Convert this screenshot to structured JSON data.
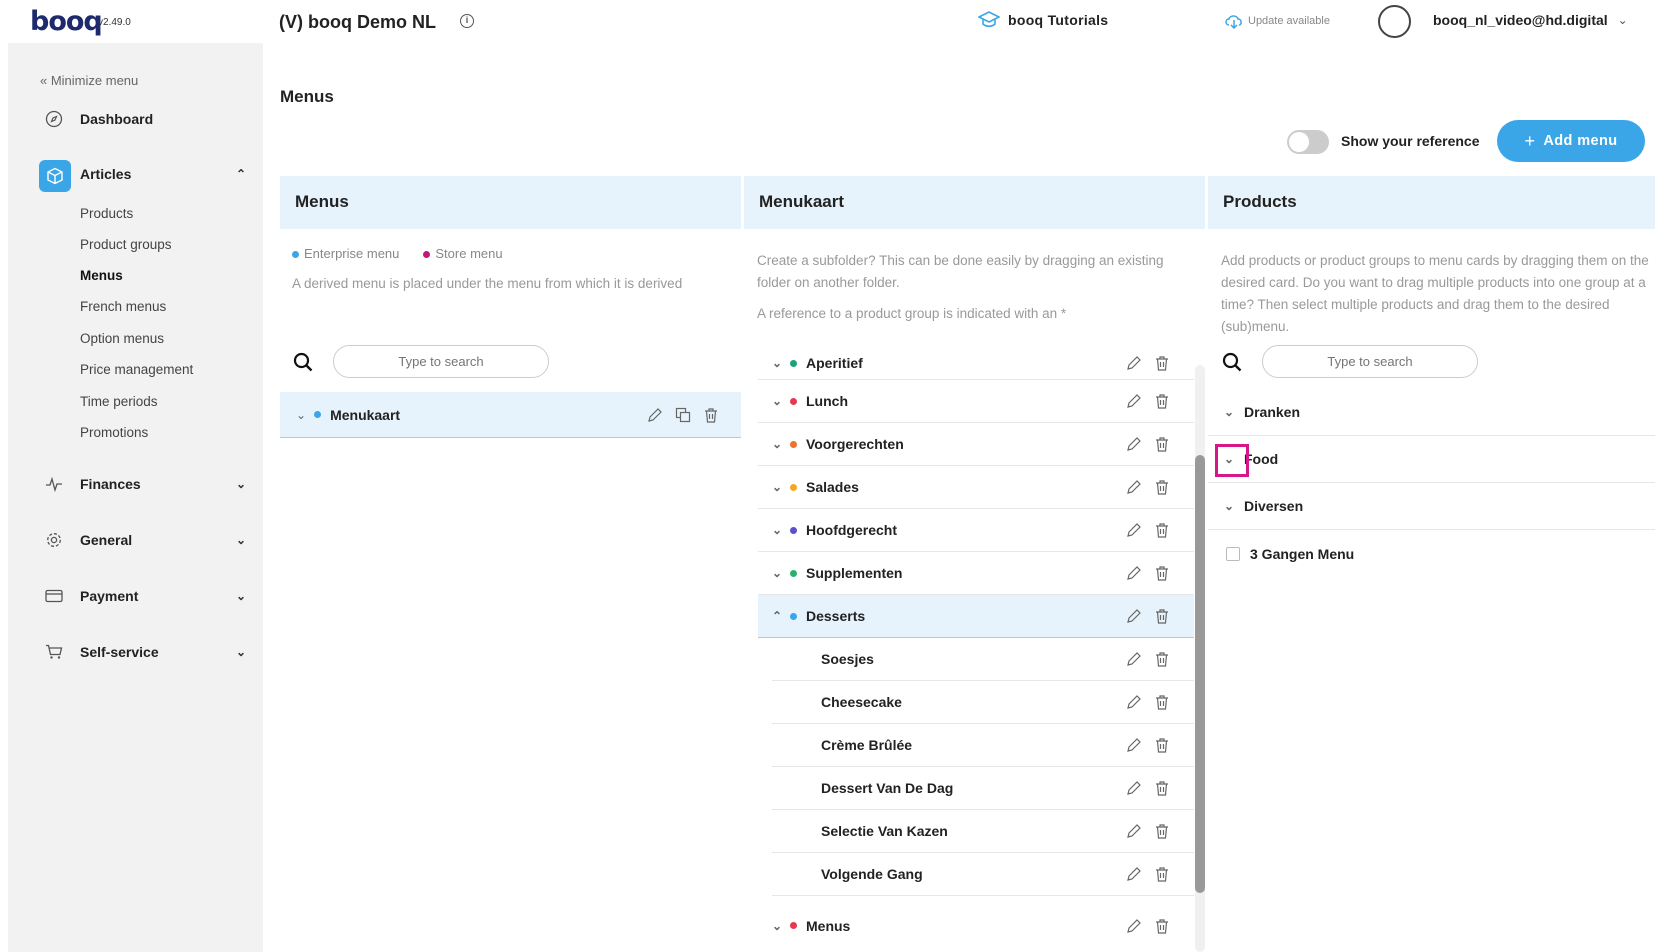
{
  "topbar": {
    "logo": "booq",
    "version": "v2.49.0",
    "venue": "(V) booq Demo NL",
    "tutorials": "booq Tutorials",
    "update": "Update available",
    "account": "booq_nl_video@hd.digital"
  },
  "sidebar": {
    "minimize": "« Minimize menu",
    "dashboard": "Dashboard",
    "articles": "Articles",
    "articles_sub": [
      "Products",
      "Product groups",
      "Menus",
      "French menus",
      "Option menus",
      "Price management",
      "Time periods",
      "Promotions"
    ],
    "finances": "Finances",
    "general": "General",
    "payment": "Payment",
    "self_service": "Self-service"
  },
  "page": {
    "title": "Menus",
    "toggle_label": "Show your reference",
    "add_button": "Add menu"
  },
  "menus_col": {
    "header": "Menus",
    "legend_enterprise": "Enterprise menu",
    "legend_store": "Store menu",
    "note": "A derived menu is placed under the menu from which it is derived",
    "search_placeholder": "Type to search",
    "item": "Menukaart"
  },
  "menukaart_col": {
    "header": "Menukaart",
    "note1": "Create a subfolder? This can be done easily by dragging an existing folder on another folder.",
    "note2": "A reference to a product group is indicated with an *",
    "rows": [
      {
        "label": "Aperitief",
        "color": "#1aa37a"
      },
      {
        "label": "Lunch",
        "color": "#e8384f"
      },
      {
        "label": "Voorgerechten",
        "color": "#f07030"
      },
      {
        "label": "Salades",
        "color": "#f5a623"
      },
      {
        "label": "Hoofdgerecht",
        "color": "#5a4fcf"
      },
      {
        "label": "Supplementen",
        "color": "#2bb06b"
      },
      {
        "label": "Desserts",
        "color": "#3aa6e8"
      }
    ],
    "children": [
      "Soesjes",
      "Cheesecake",
      "Crème Brûlée",
      "Dessert Van De Dag",
      "Selectie Van Kazen",
      "Volgende Gang"
    ],
    "last_row": {
      "label": "Menus",
      "color": "#e8384f"
    }
  },
  "products_col": {
    "header": "Products",
    "note": "Add products or product groups to menu cards by dragging them on the desired card. Do you want to drag multiple products into one group at a time? Then select multiple products and drag them to the desired (sub)menu.",
    "search_placeholder": "Type to search",
    "groups": [
      "Dranken",
      "Food",
      "Diversen"
    ],
    "single": "3 Gangen Menu"
  },
  "colors": {
    "accent": "#3aa6e8",
    "header_bg": "#e6f3fc",
    "highlight": "#d6168b",
    "enterprise_dot": "#3aa6e8",
    "store_dot": "#c2187a"
  }
}
